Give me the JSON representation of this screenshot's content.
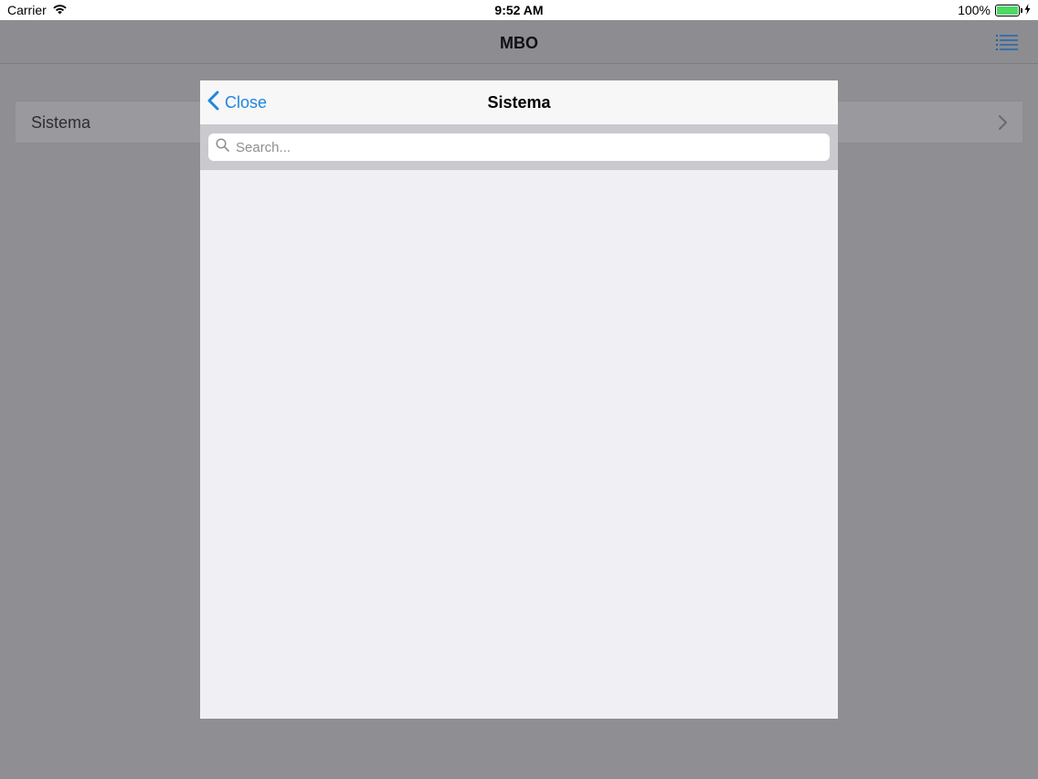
{
  "status_bar": {
    "carrier": "Carrier",
    "time": "9:52 AM",
    "battery_percent": "100%",
    "battery_level": 1.0,
    "battery_color": "#4cd964"
  },
  "app": {
    "title": "MBO",
    "menu_icon": "list-icon",
    "rows": [
      {
        "label": "Sistema"
      }
    ]
  },
  "modal": {
    "close_label": "Close",
    "title": "Sistema",
    "search": {
      "placeholder": "Search...",
      "value": ""
    }
  },
  "colors": {
    "accent": "#1f86e0",
    "dim_overlay": "#8f8e93"
  }
}
